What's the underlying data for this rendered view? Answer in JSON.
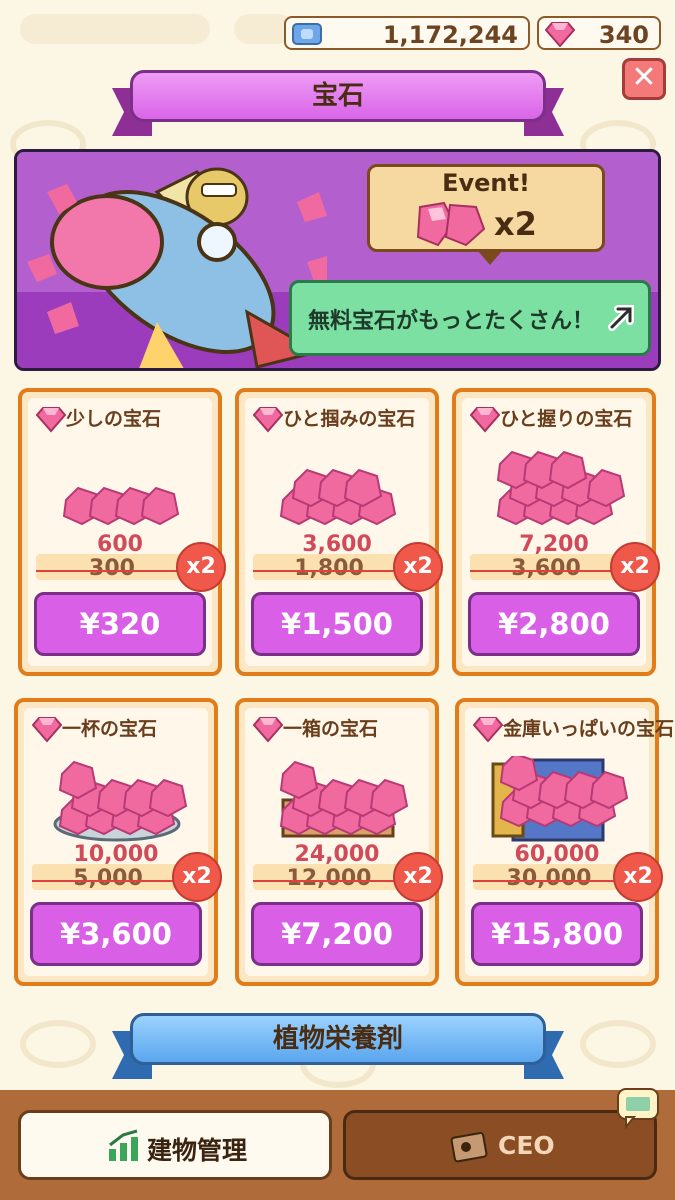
{
  "currency": {
    "money_value": "1,172,244",
    "gems_value": "340",
    "money_icon": "cash-icon",
    "gem_icon": "gem-icon"
  },
  "header": {
    "title": "宝石",
    "close_icon": "close-icon"
  },
  "banner": {
    "event_label": "Event!",
    "multiplier": "x2",
    "link_label": "無料宝石がもっとたくさん！",
    "link_icon": "external-arrow-icon"
  },
  "offers": [
    {
      "name": "少しの宝石",
      "amount": "600",
      "old_amount": "300",
      "multiplier": "x2",
      "price": "¥320"
    },
    {
      "name": "ひと掴みの宝石",
      "amount": "3,600",
      "old_amount": "1,800",
      "multiplier": "x2",
      "price": "¥1,500"
    },
    {
      "name": "ひと握りの宝石",
      "amount": "7,200",
      "old_amount": "3,600",
      "multiplier": "x2",
      "price": "¥2,800"
    },
    {
      "name": "一杯の宝石",
      "amount": "10,000",
      "old_amount": "5,000",
      "multiplier": "x2",
      "price": "¥3,600"
    },
    {
      "name": "一箱の宝石",
      "amount": "24,000",
      "old_amount": "12,000",
      "multiplier": "x2",
      "price": "¥7,200"
    },
    {
      "name": "金庫いっぱいの宝石",
      "amount": "60,000",
      "old_amount": "30,000",
      "multiplier": "x2",
      "price": "¥15,800"
    }
  ],
  "next_section": {
    "title": "植物栄養剤"
  },
  "bottom_nav": {
    "building_label": "建物管理",
    "ceo_label": "CEO"
  },
  "colors": {
    "accent": "#d95fe6",
    "card_border": "#e07d1a",
    "gem": "#f06aa0",
    "multiplier_badge": "#f0584a"
  }
}
